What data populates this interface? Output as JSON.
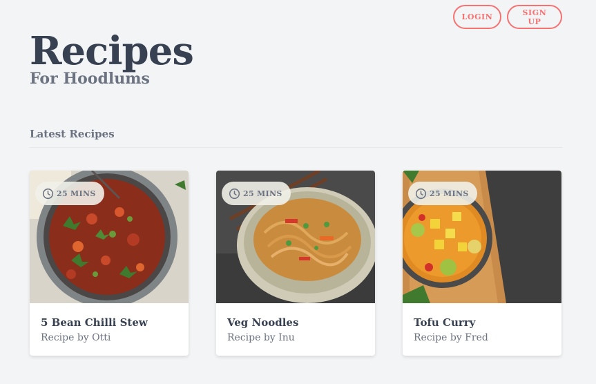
{
  "auth": {
    "login_label": "LOGIN",
    "signup_label": "SIGN UP"
  },
  "header": {
    "title": "Recipes",
    "subtitle": "For Hoodlums"
  },
  "section": {
    "title": "Latest Recipes"
  },
  "recipes": [
    {
      "time": "25 MINS",
      "title": "5 Bean Chilli Stew",
      "author": "Recipe by Otti"
    },
    {
      "time": "25 MINS",
      "title": "Veg Noodles",
      "author": "Recipe by Inu"
    },
    {
      "time": "25 MINS",
      "title": "Tofu Curry",
      "author": "Recipe by Fred"
    }
  ],
  "colors": {
    "accent": "#f87171",
    "heading": "#374151",
    "muted": "#6b7280",
    "background": "#f3f4f6"
  },
  "icons": {
    "time": "clock-icon"
  }
}
